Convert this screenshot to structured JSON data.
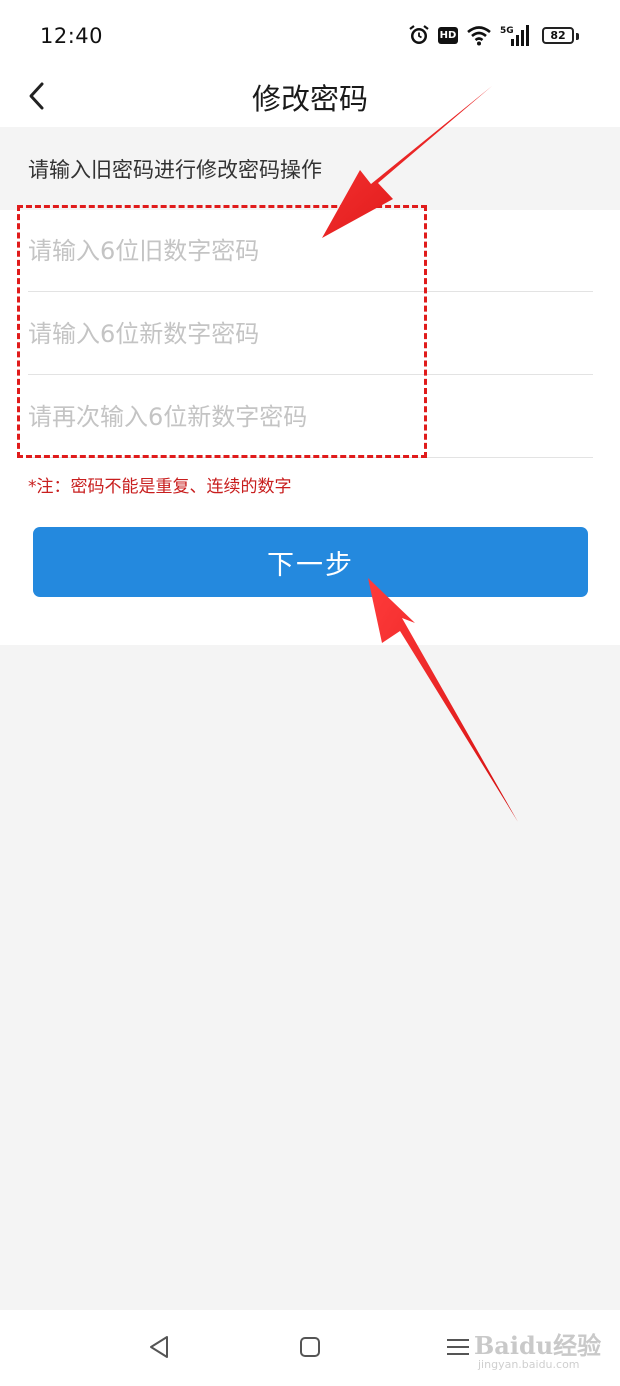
{
  "status_bar": {
    "time": "12:40",
    "hd_label": "HD",
    "network_label": "5G",
    "battery_level": "82",
    "icons": [
      "alarm-icon",
      "hd-icon",
      "wifi-icon",
      "signal-icon",
      "battery-icon"
    ]
  },
  "header": {
    "back_icon": "chevron-left-icon",
    "title": "修改密码"
  },
  "form": {
    "hint": "请输入旧密码进行修改密码操作",
    "old_password_placeholder": "请输入6位旧数字密码",
    "new_password_placeholder": "请输入6位新数字密码",
    "confirm_password_placeholder": "请再次输入6位新数字密码",
    "note": "*注：密码不能是重复、连续的数字",
    "next_label": "下一步"
  },
  "annotation": {
    "color": "#e01b1b"
  },
  "nav_bar": {
    "icons": [
      "triangle-back-icon",
      "square-home-icon",
      "menu-lines-icon"
    ],
    "watermark": "Baidu经验",
    "watermark_sub": "jingyan.baidu.com"
  },
  "colors": {
    "primary_button": "#2489de",
    "note_text": "#c81e1e",
    "background": "#f4f4f4"
  }
}
